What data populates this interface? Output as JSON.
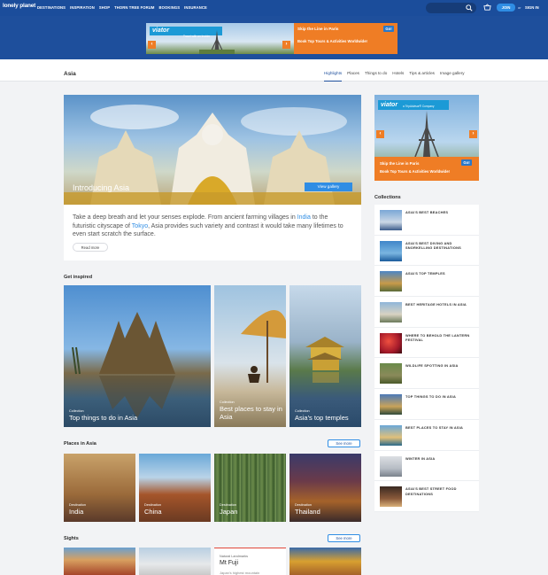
{
  "nav": {
    "logo": "lonely planet",
    "links": [
      "DESTINATIONS",
      "INSPIRATION",
      "SHOP",
      "THORN TREE FORUM",
      "BOOKINGS",
      "INSURANCE"
    ],
    "join": "JOIN",
    "or": "or",
    "signin": "SIGN IN"
  },
  "top_ad": {
    "brand": "viator",
    "tagline": "Travel with an Insider",
    "headline": "Skip the Line in Paris",
    "subline": "Book Top Tours & Activities Worldwide!",
    "go": "Go!"
  },
  "header": {
    "title": "Asia",
    "tabs": [
      "Highlights",
      "Places",
      "Things to do",
      "Hotels",
      "Tips & articles",
      "Image gallery"
    ],
    "active_tab": "Highlights"
  },
  "hero": {
    "title": "Introducing Asia",
    "gallery_button": "View gallery",
    "text_1": "Take a deep breath and let your senses explode. From ancient farming villages in ",
    "link_1": "India",
    "text_2": " to the futuristic cityscape of ",
    "link_2": "Tokyo",
    "text_3": ", Asia provides such variety and contrast it would take many lifetimes to even start scratch the surface.",
    "read_more": "Read more"
  },
  "side_ad": {
    "brand": "viator",
    "tagline": "a TripAdvisor® Company",
    "headline": "Skip the Line in Paris",
    "subline": "Book Top Tours & Activities Worldwide!",
    "go": "Go!"
  },
  "collections": {
    "title": "Collections",
    "items": [
      "ASIA'S BEST BEACHES",
      "ASIA'S BEST DIVING AND SNORKELLING DESTINATIONS",
      "ASIA'S TOP TEMPLES",
      "BEST HERITAGE HOTELS IN ASIA",
      "WHERE TO BEHOLD THE LANTERN FESTIVAL",
      "WILDLIFE SPOTTING IN ASIA",
      "TOP THINGS TO DO IN ASIA",
      "BEST PLACES TO STAY IN ASIA",
      "WINTER IN ASIA",
      "ASIA'S BEST STREET FOOD DESTINATIONS"
    ]
  },
  "inspired": {
    "title": "Get inspired",
    "tiles": [
      {
        "kicker": "Collection",
        "name": "Top things to do in Asia"
      },
      {
        "kicker": "Collection",
        "name": "Best places to stay in Asia"
      },
      {
        "kicker": "Collection",
        "name": "Asia's top temples"
      }
    ]
  },
  "places": {
    "title": "Places in Asia",
    "see_more": "See more",
    "tiles": [
      {
        "kicker": "Destination",
        "name": "India"
      },
      {
        "kicker": "Destination",
        "name": "China"
      },
      {
        "kicker": "Destination",
        "name": "Japan"
      },
      {
        "kicker": "Destination",
        "name": "Thailand"
      }
    ]
  },
  "sights": {
    "title": "Sights",
    "see_more": "See more",
    "card_kicker": "Natural Landmarks",
    "card_name": "Mt Fuji",
    "card_desc": "Japan's highest mountain"
  }
}
